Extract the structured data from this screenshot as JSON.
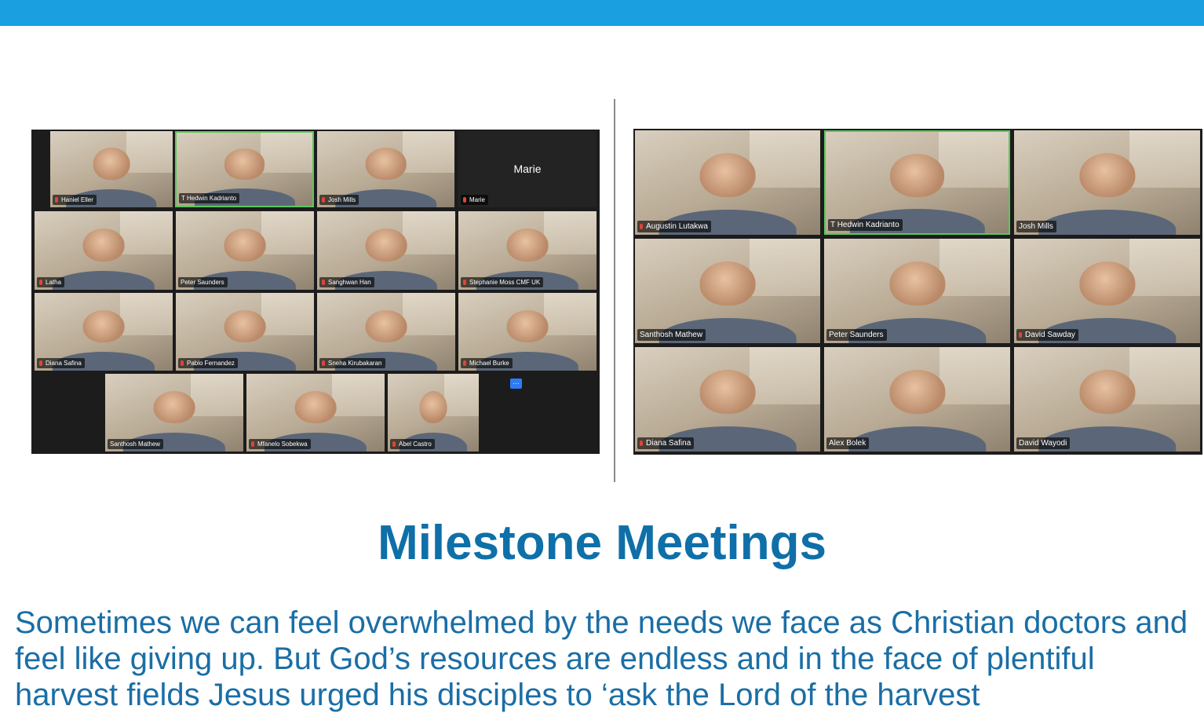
{
  "colors": {
    "top_bar": "#1a9fe0",
    "title": "#0f6fa8",
    "body": "#1a6ea6",
    "active_speaker": "#5ec65e",
    "muted_mic": "#e0443a"
  },
  "left_meeting": {
    "participants": [
      {
        "name": "Haniel Eller"
      },
      {
        "name": "T Hedwin Kadrianto",
        "active": true
      },
      {
        "name": "Josh Mills"
      },
      {
        "name": "Marie",
        "video_off_label": "Marie"
      },
      {
        "name": "Latha"
      },
      {
        "name": "Peter Saunders"
      },
      {
        "name": "Sanghwan Han"
      },
      {
        "name": "Stephanie Moss CMF UK"
      },
      {
        "name": "Diana Safina"
      },
      {
        "name": "Pablo Fernandez"
      },
      {
        "name": "Sneha Kirubakaran"
      },
      {
        "name": "Michael Burke"
      },
      {
        "name": "Santhosh Mathew"
      },
      {
        "name": "Mfanelo Sobekwa"
      },
      {
        "name": "Abel Castro"
      }
    ],
    "more_icon": "ellipsis-icon",
    "more_label": "…"
  },
  "right_meeting": {
    "participants": [
      {
        "name": "Augustin Lutakwa"
      },
      {
        "name": "T Hedwin Kadrianto",
        "active": true
      },
      {
        "name": "Josh Mills"
      },
      {
        "name": "Santhosh Mathew"
      },
      {
        "name": "Peter Saunders"
      },
      {
        "name": "David Sawday"
      },
      {
        "name": "Diana Safina"
      },
      {
        "name": "Alex Bolek"
      },
      {
        "name": "David Wayodi"
      }
    ]
  },
  "title": "Milestone Meetings",
  "body": "Sometimes we can feel overwhelmed by the needs we face as Christian doctors and feel like giving up. But God’s resources are endless and in the face of plentiful harvest fields Jesus urged his disciples to ‘ask the Lord of the harvest"
}
